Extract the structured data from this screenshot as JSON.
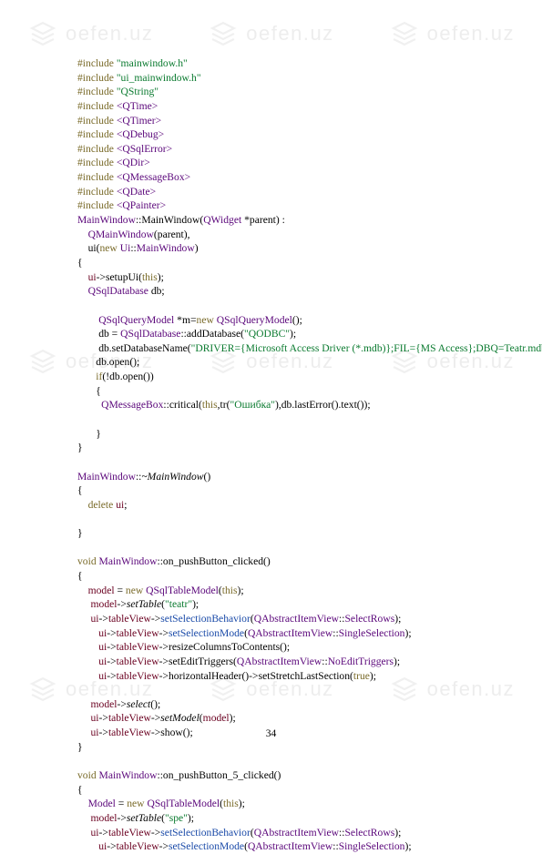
{
  "watermark_text": "oefen.uz",
  "page_number": "34",
  "lines": [
    [
      [
        "kw",
        "#include"
      ],
      [
        "dk",
        " "
      ],
      [
        "str",
        "\"mainwindow.h\""
      ]
    ],
    [
      [
        "kw",
        "#include"
      ],
      [
        "dk",
        " "
      ],
      [
        "str",
        "\"ui_mainwindow.h\""
      ]
    ],
    [
      [
        "kw",
        "#include"
      ],
      [
        "dk",
        " "
      ],
      [
        "str",
        "\"QString\""
      ]
    ],
    [
      [
        "kw",
        "#include"
      ],
      [
        "dk",
        " "
      ],
      [
        "ang",
        "<QTime>"
      ]
    ],
    [
      [
        "kw",
        "#include"
      ],
      [
        "dk",
        " "
      ],
      [
        "ang",
        "<QTimer>"
      ]
    ],
    [
      [
        "kw",
        "#include"
      ],
      [
        "dk",
        " "
      ],
      [
        "ang",
        "<QDebug>"
      ]
    ],
    [
      [
        "kw",
        "#include"
      ],
      [
        "dk",
        " "
      ],
      [
        "ang",
        "<QSqlError>"
      ]
    ],
    [
      [
        "kw",
        "#include"
      ],
      [
        "dk",
        " "
      ],
      [
        "ang",
        "<QDir>"
      ]
    ],
    [
      [
        "kw",
        "#include"
      ],
      [
        "dk",
        " "
      ],
      [
        "ang",
        "<QMessageBox>"
      ]
    ],
    [
      [
        "kw",
        "#include"
      ],
      [
        "dk",
        " "
      ],
      [
        "ang",
        "<QDate>"
      ]
    ],
    [
      [
        "kw",
        "#include"
      ],
      [
        "dk",
        " "
      ],
      [
        "ang",
        "<QPainter>"
      ]
    ],
    [
      [
        "cls",
        "MainWindow"
      ],
      [
        "dk",
        "::MainWindow("
      ],
      [
        "cls",
        "QWidget"
      ],
      [
        "dk",
        " *parent) :"
      ]
    ],
    [
      [
        "dk",
        "    "
      ],
      [
        "cls",
        "QMainWindow"
      ],
      [
        "dk",
        "(parent),"
      ]
    ],
    [
      [
        "dk",
        "    ui("
      ],
      [
        "trd",
        "new"
      ],
      [
        "dk",
        " "
      ],
      [
        "cls",
        "Ui"
      ],
      [
        "dk",
        "::"
      ],
      [
        "cls",
        "MainWindow"
      ],
      [
        "dk",
        ")"
      ]
    ],
    [
      [
        "dk",
        "{"
      ]
    ],
    [
      [
        "dk",
        "    "
      ],
      [
        "id",
        "ui"
      ],
      [
        "dk",
        "->setupUi("
      ],
      [
        "trd",
        "this"
      ],
      [
        "dk",
        ");"
      ]
    ],
    [
      [
        "dk",
        "    "
      ],
      [
        "cls",
        "QSqlDatabase"
      ],
      [
        "dk",
        " db;"
      ]
    ],
    [
      [
        "dk",
        " "
      ]
    ],
    [
      [
        "dk",
        "        "
      ],
      [
        "cls",
        "QSqlQueryModel"
      ],
      [
        "dk",
        " *m="
      ],
      [
        "trd",
        "new"
      ],
      [
        "dk",
        " "
      ],
      [
        "cls",
        "QSqlQueryModel"
      ],
      [
        "dk",
        "();"
      ]
    ],
    [
      [
        "dk",
        "        db = "
      ],
      [
        "cls",
        "QSqlDatabase"
      ],
      [
        "dk",
        "::addDatabase("
      ],
      [
        "str",
        "\"QODBC\""
      ],
      [
        "dk",
        ");"
      ]
    ],
    [
      [
        "dk",
        "        db.setDatabaseName("
      ],
      [
        "str",
        "\"DRIVER={Microsoft Access Driver (*.mdb)};FIL={MS Access};DBQ=Teatr.mdb\""
      ],
      [
        "dk",
        ");"
      ]
    ],
    [
      [
        "dk",
        "       db.open();"
      ]
    ],
    [
      [
        "dk",
        "       "
      ],
      [
        "trd",
        "if"
      ],
      [
        "dk",
        "(!db.open())"
      ]
    ],
    [
      [
        "dk",
        "       {"
      ]
    ],
    [
      [
        "dk",
        "         "
      ],
      [
        "cls",
        "QMessageBox"
      ],
      [
        "dk",
        "::critical("
      ],
      [
        "trd",
        "this"
      ],
      [
        "dk",
        ",tr("
      ],
      [
        "str",
        "\"Ошибка\""
      ],
      [
        "dk",
        "),db.lastError().text());"
      ]
    ],
    [
      [
        "dk",
        " "
      ]
    ],
    [
      [
        "dk",
        "       }"
      ]
    ],
    [
      [
        "dk",
        "}"
      ]
    ],
    [
      [
        "dk",
        " "
      ]
    ],
    [
      [
        "cls",
        "MainWindow"
      ],
      [
        "dk",
        "::"
      ],
      [
        "mth",
        "~MainWindow"
      ],
      [
        "dk",
        "()"
      ]
    ],
    [
      [
        "dk",
        "{"
      ]
    ],
    [
      [
        "dk",
        "    "
      ],
      [
        "trd",
        "delete"
      ],
      [
        "dk",
        " "
      ],
      [
        "id",
        "ui"
      ],
      [
        "dk",
        ";"
      ]
    ],
    [
      [
        "dk",
        " "
      ]
    ],
    [
      [
        "dk",
        "}"
      ]
    ],
    [
      [
        "dk",
        " "
      ]
    ],
    [
      [
        "kw",
        "void"
      ],
      [
        "dk",
        " "
      ],
      [
        "cls",
        "MainWindow"
      ],
      [
        "dk",
        "::on_pushButton_clicked()"
      ]
    ],
    [
      [
        "dk",
        "{"
      ]
    ],
    [
      [
        "dk",
        "    "
      ],
      [
        "id",
        "model"
      ],
      [
        "dk",
        " = "
      ],
      [
        "trd",
        "new"
      ],
      [
        "dk",
        " "
      ],
      [
        "cls",
        "QSqlTableModel"
      ],
      [
        "dk",
        "("
      ],
      [
        "trd",
        "this"
      ],
      [
        "dk",
        ");"
      ]
    ],
    [
      [
        "dk",
        "     "
      ],
      [
        "id",
        "model"
      ],
      [
        "dk",
        "->"
      ],
      [
        "mth",
        "setTable"
      ],
      [
        "dk",
        "("
      ],
      [
        "str",
        "\"teatr\""
      ],
      [
        "dk",
        ");"
      ]
    ],
    [
      [
        "dk",
        "     "
      ],
      [
        "id",
        "ui"
      ],
      [
        "dk",
        "->"
      ],
      [
        "id",
        "tableView"
      ],
      [
        "dk",
        "->"
      ],
      [
        "blu",
        "setSelectionBehavior"
      ],
      [
        "dk",
        "("
      ],
      [
        "cls",
        "QAbstractItemView"
      ],
      [
        "dk",
        "::"
      ],
      [
        "cls",
        "SelectRows"
      ],
      [
        "dk",
        ");"
      ]
    ],
    [
      [
        "dk",
        "        "
      ],
      [
        "id",
        "ui"
      ],
      [
        "dk",
        "->"
      ],
      [
        "id",
        "tableView"
      ],
      [
        "dk",
        "->"
      ],
      [
        "blu",
        "setSelectionMode"
      ],
      [
        "dk",
        "("
      ],
      [
        "cls",
        "QAbstractItemView"
      ],
      [
        "dk",
        "::"
      ],
      [
        "cls",
        "SingleSelection"
      ],
      [
        "dk",
        ");"
      ]
    ],
    [
      [
        "dk",
        "        "
      ],
      [
        "id",
        "ui"
      ],
      [
        "dk",
        "->"
      ],
      [
        "id",
        "tableView"
      ],
      [
        "dk",
        "->resizeColumnsToContents();"
      ]
    ],
    [
      [
        "dk",
        "        "
      ],
      [
        "id",
        "ui"
      ],
      [
        "dk",
        "->"
      ],
      [
        "id",
        "tableView"
      ],
      [
        "dk",
        "->setEditTriggers("
      ],
      [
        "cls",
        "QAbstractItemView"
      ],
      [
        "dk",
        "::"
      ],
      [
        "cls",
        "NoEditTriggers"
      ],
      [
        "dk",
        ");"
      ]
    ],
    [
      [
        "dk",
        "        "
      ],
      [
        "id",
        "ui"
      ],
      [
        "dk",
        "->"
      ],
      [
        "id",
        "tableView"
      ],
      [
        "dk",
        "->horizontalHeader()->setStretchLastSection("
      ],
      [
        "trd",
        "true"
      ],
      [
        "dk",
        ");"
      ]
    ],
    [
      [
        "dk",
        " "
      ]
    ],
    [
      [
        "dk",
        "     "
      ],
      [
        "id",
        "model"
      ],
      [
        "dk",
        "->"
      ],
      [
        "mth",
        "select"
      ],
      [
        "dk",
        "();"
      ]
    ],
    [
      [
        "dk",
        "     "
      ],
      [
        "id",
        "ui"
      ],
      [
        "dk",
        "->"
      ],
      [
        "id",
        "tableView"
      ],
      [
        "dk",
        "->"
      ],
      [
        "mth",
        "setModel"
      ],
      [
        "dk",
        "("
      ],
      [
        "id",
        "model"
      ],
      [
        "dk",
        ");"
      ]
    ],
    [
      [
        "dk",
        "     "
      ],
      [
        "id",
        "ui"
      ],
      [
        "dk",
        "->"
      ],
      [
        "id",
        "tableView"
      ],
      [
        "dk",
        "->show();"
      ]
    ],
    [
      [
        "dk",
        "}"
      ]
    ],
    [
      [
        "dk",
        " "
      ]
    ],
    [
      [
        "kw",
        "void"
      ],
      [
        "dk",
        " "
      ],
      [
        "cls",
        "MainWindow"
      ],
      [
        "dk",
        "::on_pushButton_5_clicked()"
      ]
    ],
    [
      [
        "dk",
        "{"
      ]
    ],
    [
      [
        "dk",
        "    "
      ],
      [
        "cls",
        "Model"
      ],
      [
        "dk",
        " = "
      ],
      [
        "trd",
        "new"
      ],
      [
        "dk",
        " "
      ],
      [
        "cls",
        "QSqlTableModel"
      ],
      [
        "dk",
        "("
      ],
      [
        "trd",
        "this"
      ],
      [
        "dk",
        ");"
      ]
    ],
    [
      [
        "dk",
        "     "
      ],
      [
        "id",
        "model"
      ],
      [
        "dk",
        "->"
      ],
      [
        "mth",
        "setTable"
      ],
      [
        "dk",
        "("
      ],
      [
        "str",
        "\"spe\""
      ],
      [
        "dk",
        ");"
      ]
    ],
    [
      [
        "dk",
        "     "
      ],
      [
        "id",
        "ui"
      ],
      [
        "dk",
        "->"
      ],
      [
        "id",
        "tableView"
      ],
      [
        "dk",
        "->"
      ],
      [
        "blu",
        "setSelectionBehavior"
      ],
      [
        "dk",
        "("
      ],
      [
        "cls",
        "QAbstractItemView"
      ],
      [
        "dk",
        "::"
      ],
      [
        "cls",
        "SelectRows"
      ],
      [
        "dk",
        ");"
      ]
    ],
    [
      [
        "dk",
        "        "
      ],
      [
        "id",
        "ui"
      ],
      [
        "dk",
        "->"
      ],
      [
        "id",
        "tableView"
      ],
      [
        "dk",
        "->"
      ],
      [
        "blu",
        "setSelectionMode"
      ],
      [
        "dk",
        "("
      ],
      [
        "cls",
        "QAbstractItemView"
      ],
      [
        "dk",
        "::"
      ],
      [
        "cls",
        "SingleSelection"
      ],
      [
        "dk",
        ");"
      ]
    ]
  ]
}
